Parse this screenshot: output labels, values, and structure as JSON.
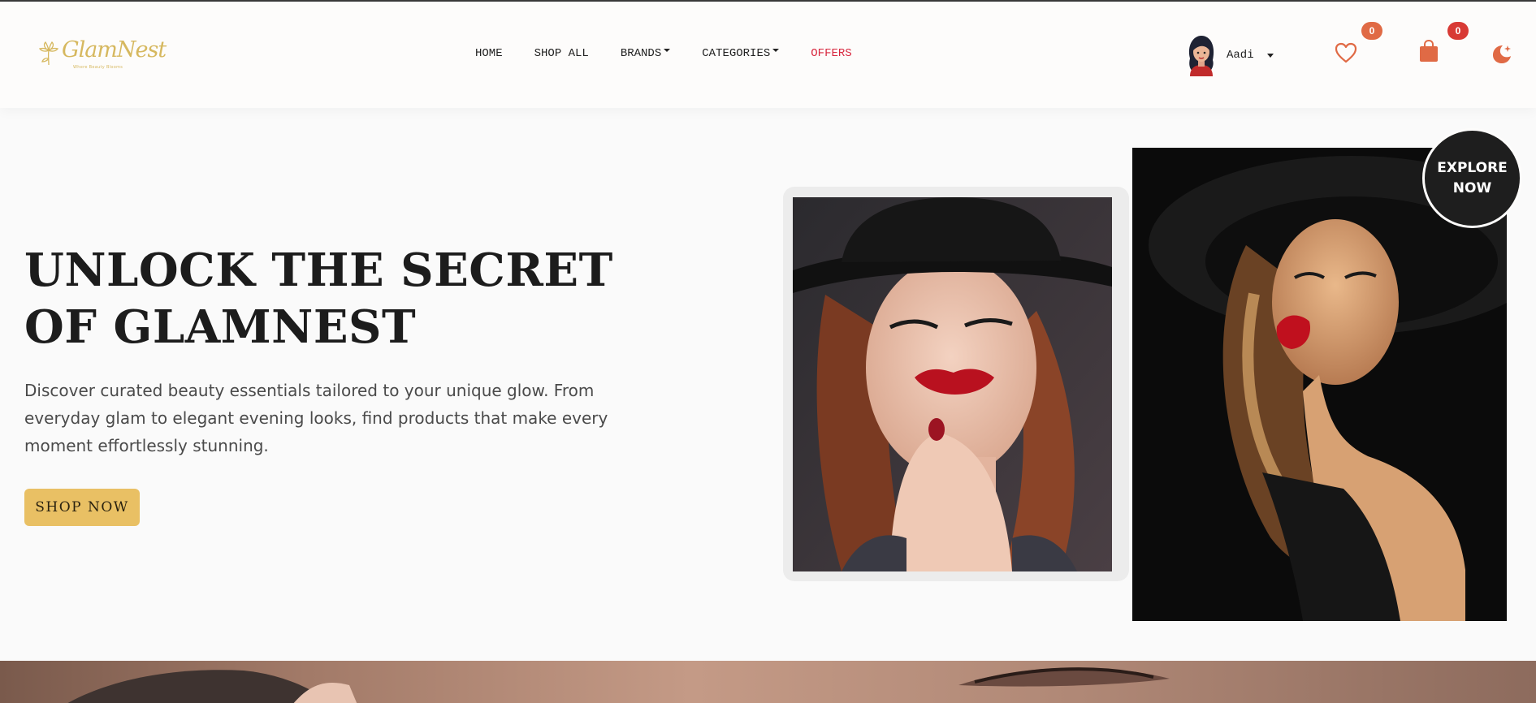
{
  "brand": {
    "name": "GlamNest",
    "tagline": "Where Beauty Blooms"
  },
  "nav": {
    "items": [
      {
        "label": "HOME",
        "dropdown": false
      },
      {
        "label": "SHOP ALL",
        "dropdown": false
      },
      {
        "label": "BRANDS",
        "dropdown": true
      },
      {
        "label": "CATEGORIES",
        "dropdown": true
      },
      {
        "label": "OFFERS",
        "dropdown": false
      }
    ]
  },
  "user": {
    "name": "Aadi"
  },
  "wishlist": {
    "count": "0"
  },
  "cart": {
    "count": "0"
  },
  "hero": {
    "title": "UNLOCK THE SECRET OF GLAMNEST",
    "description": "Discover curated beauty essentials tailored to your unique glow. From everyday glam to elegant evening looks, find products that make every moment effortlessly stunning.",
    "cta_label": "SHOP NOW",
    "explore_line1": "EXPLORE",
    "explore_line2": "NOW"
  },
  "colors": {
    "accent_gold": "#e9c064",
    "logo_gold": "#d6b85f",
    "icon_orange": "#e06a45",
    "offers_red": "#d8283f",
    "dark": "#1c1c1c"
  },
  "icons": {
    "wishlist": "heart-icon",
    "cart": "shopping-bag-icon",
    "theme": "moon-icon"
  }
}
